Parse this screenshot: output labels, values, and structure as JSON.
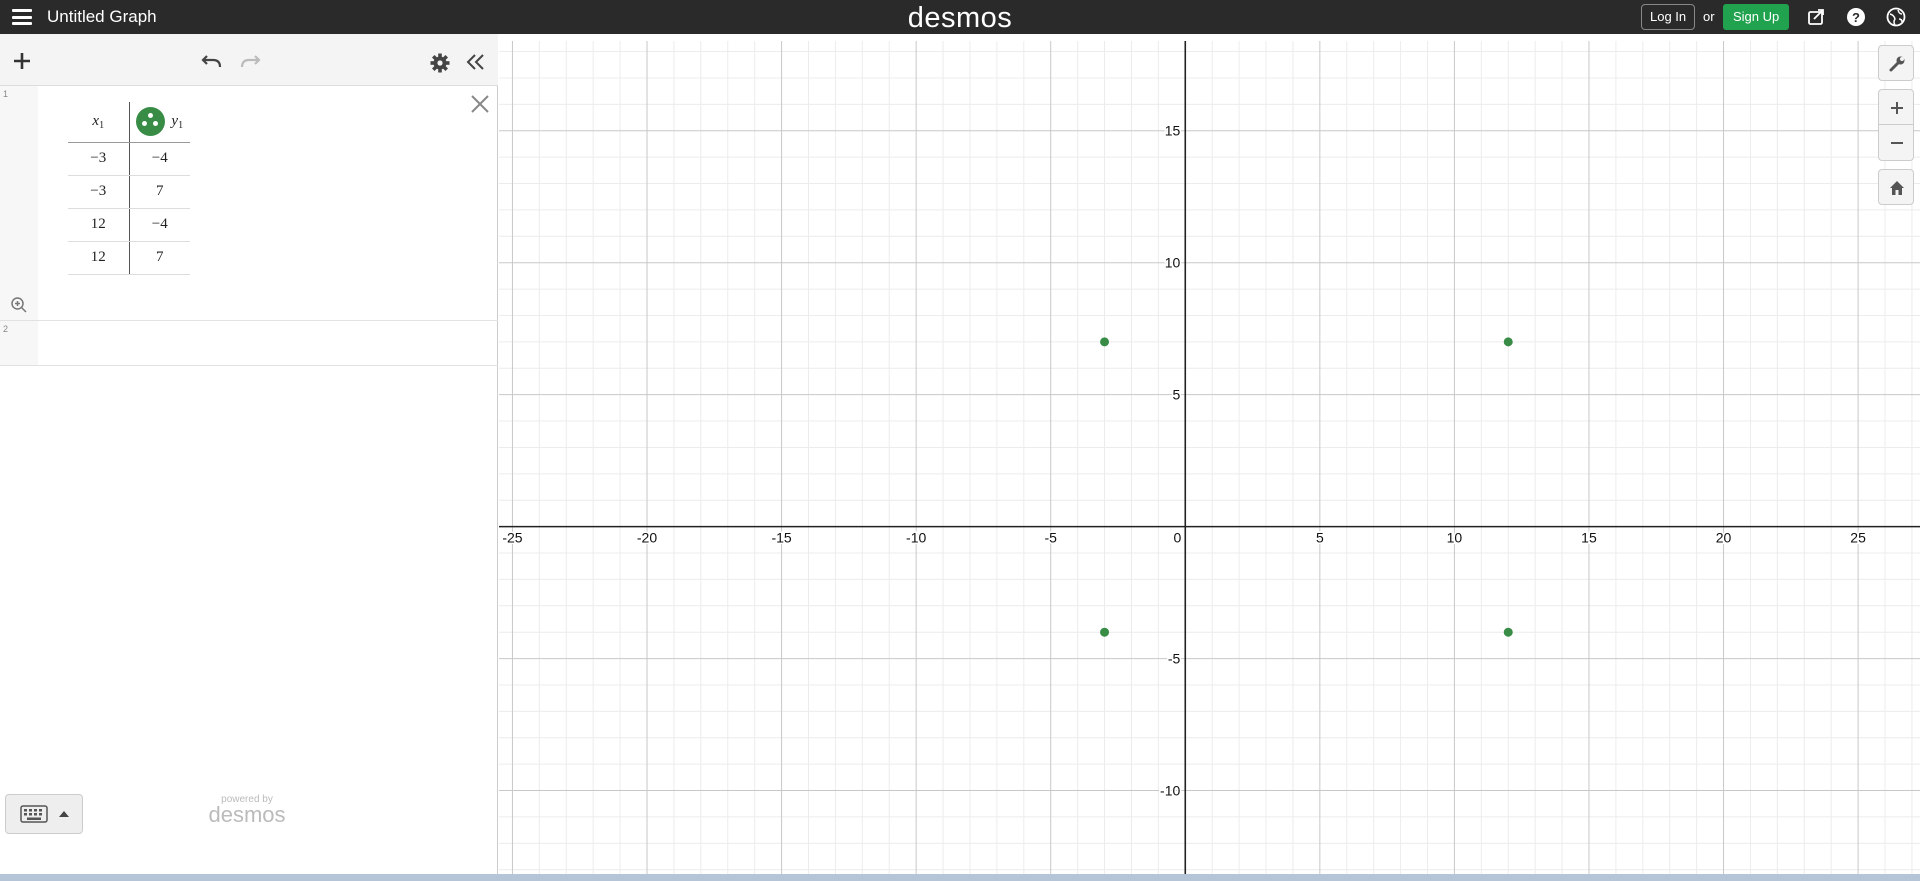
{
  "app": {
    "title": "Untitled Graph",
    "brand": "desmos",
    "login_label": "Log In",
    "or_label": "or",
    "signup_label": "Sign Up",
    "powered_by": "powered by",
    "powered_brand": "desmos"
  },
  "icons": {
    "menu": "hamburger-icon",
    "share": "share-icon",
    "help": "help-icon",
    "language": "globe-icon",
    "add": "plus-icon",
    "undo": "undo-icon",
    "redo": "redo-icon",
    "settings": "gear-icon",
    "collapse": "double-chevron-left-icon",
    "delete": "close-icon",
    "zoom_fit": "zoom-fit-icon",
    "keyboard": "keyboard-icon",
    "graph_settings": "wrench-icon",
    "zoom_in": "plus-icon",
    "zoom_out": "minus-icon",
    "default_view": "home-icon"
  },
  "colors": {
    "topbar": "#2a2a2a",
    "signup": "#21a24e",
    "series": "#388c46"
  },
  "expressions": [
    {
      "number": "1",
      "type": "table",
      "columns": [
        {
          "name": "x",
          "subscript": "1"
        },
        {
          "name": "y",
          "subscript": "1"
        }
      ],
      "rows": [
        [
          "−3",
          "−4"
        ],
        [
          "−3",
          "7"
        ],
        [
          "12",
          "−4"
        ],
        [
          "12",
          "7"
        ]
      ]
    },
    {
      "number": "2",
      "type": "empty"
    }
  ],
  "chart_data": {
    "type": "scatter",
    "series": [
      {
        "x": [
          -3,
          -3,
          12,
          12
        ],
        "y": [
          -4,
          7,
          -4,
          7
        ],
        "color": "#388c46"
      }
    ],
    "xlim": [
      -25.5,
      27.3
    ],
    "ylim": [
      -13.2,
      18.4
    ],
    "x_ticks": [
      -25,
      -20,
      -15,
      -10,
      -5,
      0,
      5,
      10,
      15,
      20,
      25
    ],
    "x_tick_labels": [
      "-25",
      "-20",
      "-15",
      "-10",
      "-5",
      "0",
      "5",
      "10",
      "15",
      "20",
      "25"
    ],
    "y_ticks": [
      15,
      10,
      5,
      -5,
      -10
    ],
    "y_tick_labels": [
      "15",
      "10",
      "5",
      "-5",
      "-10"
    ],
    "minor_step": 1,
    "grid": true
  }
}
